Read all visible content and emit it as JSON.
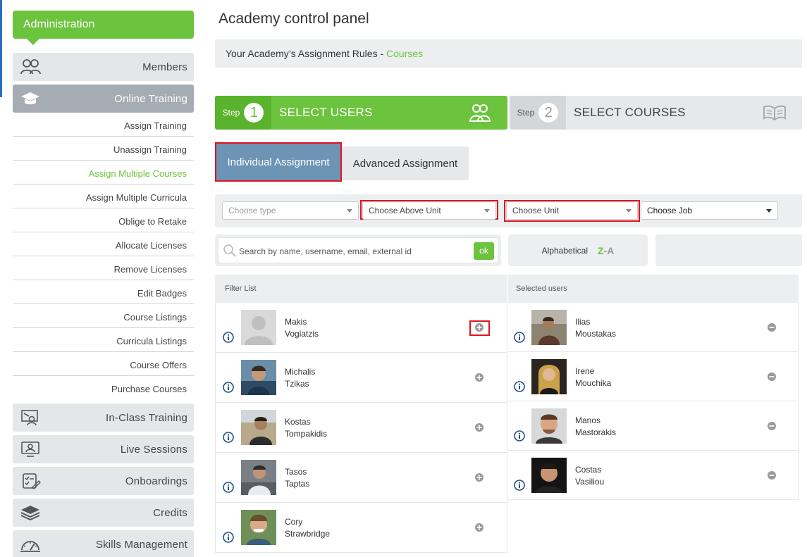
{
  "sidebar": {
    "header": "Administration",
    "top_items": [
      {
        "label": "Members",
        "icon": "members-icon"
      },
      {
        "label": "Online Training",
        "icon": "graduation-cap-icon",
        "active": true
      }
    ],
    "sub_items": [
      "Assign Training",
      "Unassign Training",
      "Assign Multiple Courses",
      "Assign Multiple Curricula",
      "Oblige to Retake",
      "Allocate Licenses",
      "Remove Licenses",
      "Edit Badges",
      "Course Listings",
      "Curricula Listings",
      "Course Offers",
      "Purchase Courses"
    ],
    "sub_active": "Assign Multiple Courses",
    "bottom_items": [
      {
        "label": "In-Class Training",
        "icon": "classroom-icon"
      },
      {
        "label": "Live Sessions",
        "icon": "live-session-icon"
      },
      {
        "label": "Onboardings",
        "icon": "onboarding-icon"
      },
      {
        "label": "Credits",
        "icon": "credits-stack-icon"
      },
      {
        "label": "Skills Management",
        "icon": "gauge-icon"
      }
    ]
  },
  "page": {
    "title": "Academy control panel",
    "rules_prefix": "Your Academy’s Assignment Rules - ",
    "rules_link": "Courses"
  },
  "steps": [
    {
      "word": "Step",
      "number": "1",
      "label": "SELECT USERS"
    },
    {
      "word": "Step",
      "number": "2",
      "label": "SELECT COURSES"
    }
  ],
  "tabs": {
    "individual": "Individual Assignment",
    "advanced": "Advanced Assignment"
  },
  "filters": {
    "type": "Choose type",
    "above_unit": "Choose Above Unit",
    "unit": "Choose Unit",
    "job": "Choose Job"
  },
  "search": {
    "placeholder": "Search by name, username, email, external id",
    "ok": "ok"
  },
  "sort": {
    "label": "Alphabetical",
    "z": "Z",
    "dash": "-",
    "a": "A"
  },
  "lists": {
    "filter_header": "Filter List",
    "selected_header": "Selected users",
    "filter_users": [
      {
        "first": "Makis",
        "last": "Vogiatzis"
      },
      {
        "first": "Michalis",
        "last": "Tzikas"
      },
      {
        "first": "Kostas",
        "last": "Tompakidis"
      },
      {
        "first": "Tasos",
        "last": "Taptas"
      },
      {
        "first": "Cory",
        "last": "Strawbridge"
      }
    ],
    "selected_users": [
      {
        "first": "Ilias",
        "last": "Moustakas"
      },
      {
        "first": "Irene",
        "last": "Mouchika"
      },
      {
        "first": "Manos",
        "last": "Mastorakis"
      },
      {
        "first": "Costas",
        "last": "Vasiliou"
      }
    ]
  },
  "colors": {
    "accent_green": "#6cc33d",
    "tab_blue": "#6d94b5",
    "highlight_red": "#e0141e",
    "panel_gray": "#eceeef"
  }
}
